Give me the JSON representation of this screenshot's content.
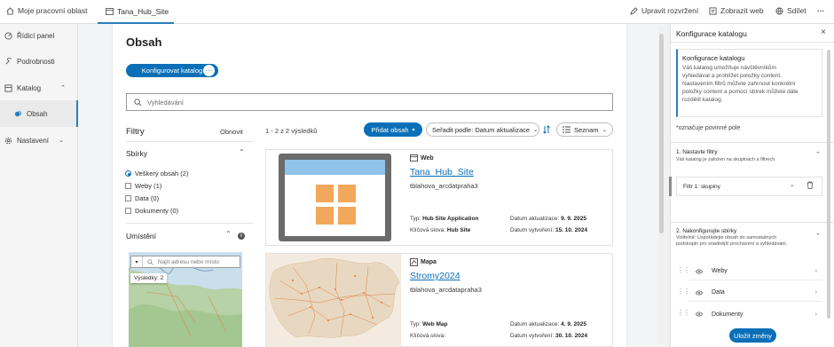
{
  "topbar": {
    "workspace": "Moje pracovní oblast",
    "site_tab": "Tana_Hub_Site",
    "edit_layout": "Upravit rozvržení",
    "view_web": "Zobrazit web",
    "share": "Sdílet",
    "more": "···"
  },
  "sidebar": {
    "items": [
      {
        "label": "Řídicí panel"
      },
      {
        "label": "Podrobnosti"
      },
      {
        "label": "Katalog"
      },
      {
        "label": "Obsah"
      },
      {
        "label": "Nastavení"
      }
    ]
  },
  "content": {
    "title": "Obsah",
    "configure_button": "Konfigurovat katalog",
    "more_button": "···",
    "search_placeholder": "Vyhledávání",
    "filters_title": "Filtry",
    "refresh": "Obnovit",
    "results": "1 - 2 z 2 výsledků",
    "add_content": "Přidat obsah",
    "sort_label": "Seřadit podle: Datum aktualizace",
    "view_label": "Seznam",
    "collections_title": "Sbírky",
    "collections": [
      {
        "label": "Veškerý obsah (2)",
        "selected": true
      },
      {
        "label": "Weby (1)",
        "selected": false
      },
      {
        "label": "Data (0)",
        "selected": false
      },
      {
        "label": "Dokumenty (0)",
        "selected": false
      }
    ],
    "location_title": "Umístění",
    "map_search_placeholder": "Najít adresu nebo místo",
    "map_results": "Výsledky: 2"
  },
  "cards": [
    {
      "type": "Web",
      "title": "Tana_Hub_Site",
      "owner": "tblahova_arcdatpraha3",
      "type_label": "Typ:",
      "type_value": "Hub Site Application",
      "keywords_label": "Klíčová slova:",
      "keywords_value": "Hub Site",
      "updated_label": "Datum aktualizace:",
      "updated_value": "9. 9. 2025",
      "created_label": "Datum vytvoření:",
      "created_value": "15. 10. 2024"
    },
    {
      "type": "Mapa",
      "title": "Stromy2024",
      "owner": "tblahova_arcdatapraha3",
      "type_label": "Typ:",
      "type_value": "Web Map",
      "keywords_label": "Klíčová slova:",
      "keywords_value": "",
      "updated_label": "Datum aktualizace:",
      "updated_value": "4. 9. 2025",
      "created_label": "Datum vytvoření:",
      "created_value": "30. 10. 2024"
    }
  ],
  "rpanel": {
    "title": "Konfigurace katalogu",
    "close": "×",
    "info_title": "Konfigurace katalogu",
    "info_text_1": "Váš katalog umožňuje návštěvníkům",
    "info_text_2": "vyhledávat a prohlížet položky content.",
    "info_text_3": "Nastavením filtrů můžete zahrnout konkrétní",
    "info_text_4": "položky content a pomocí sbírek můžete dále",
    "info_text_5": "rozdělit katalog.",
    "required_note": "*označuje povinné pole",
    "step1_title": "1. Nastavte filtry",
    "step1_desc": "Váš katalog je založen na skupinách a filtrech.",
    "filter1": "Filtr 1: skupiny",
    "step2_title": "2. Nakonfigurujte sbírky",
    "step2_desc_1": "Volitelné: Uspořádejte obsah do samostatných",
    "step2_desc_2": "podskupin pro snadnější procházení a vyhledávání.",
    "collections": [
      {
        "label": "Weby"
      },
      {
        "label": "Data"
      },
      {
        "label": "Dokumenty"
      }
    ],
    "save_button": "Uložit změny"
  },
  "colors": {
    "accent": "#0a6fb7",
    "site_icon_frame": "#6b6b6b",
    "site_icon_header": "#8fc3ea",
    "site_icon_tiles": "#f2a85a"
  }
}
